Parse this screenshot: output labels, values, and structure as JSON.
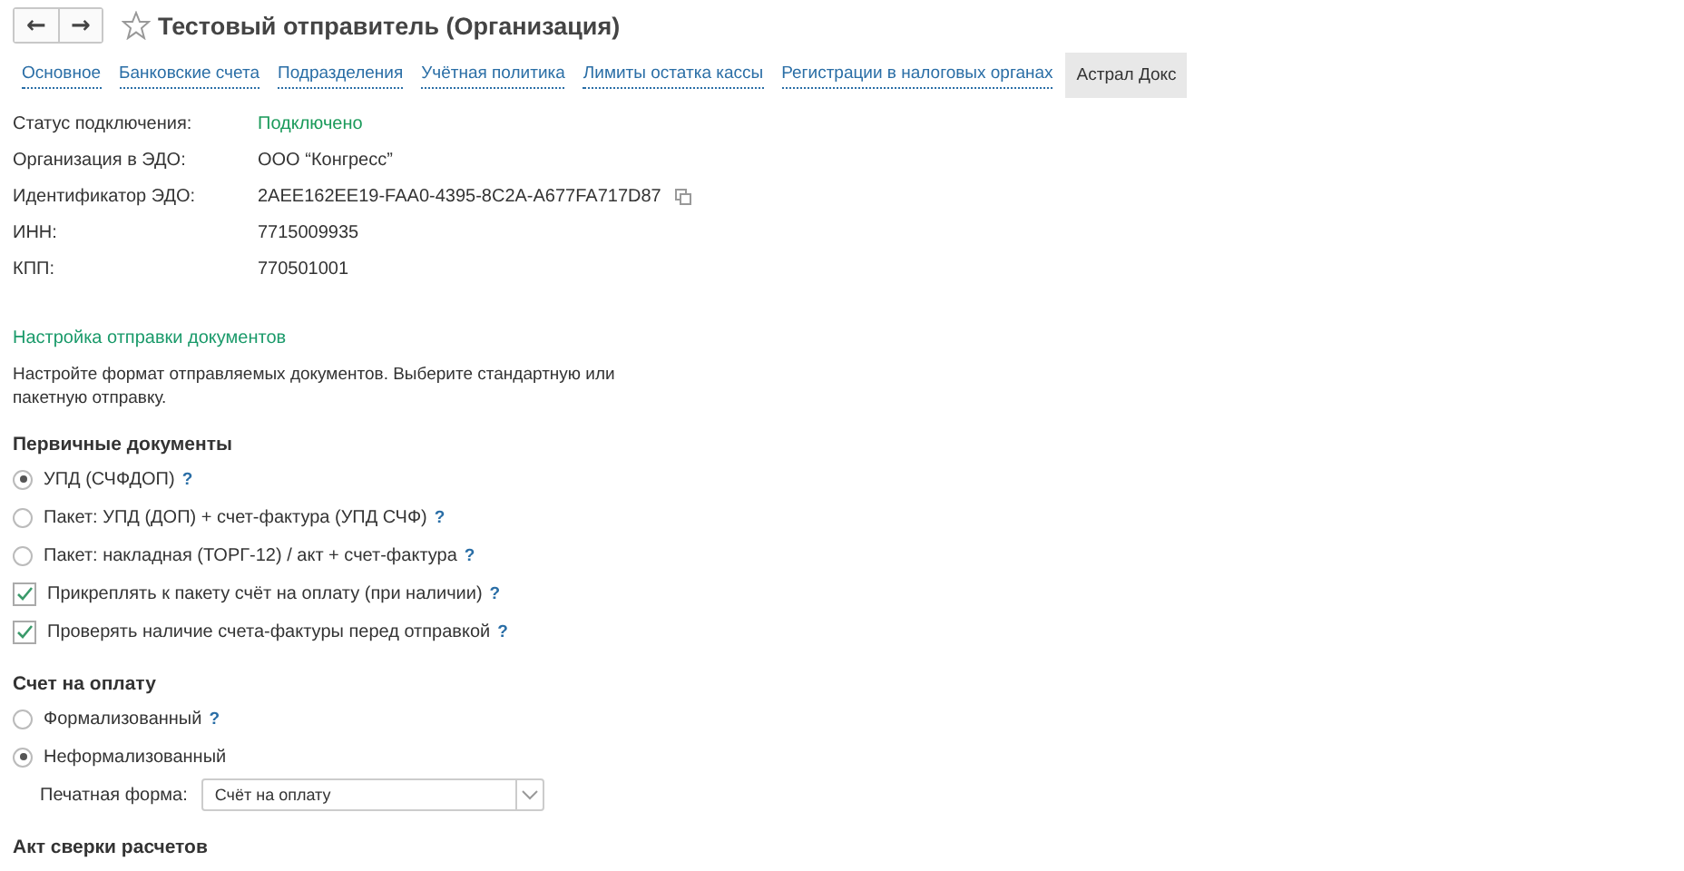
{
  "nav": {
    "back": "←",
    "forward": "→"
  },
  "window": {
    "title": "Тестовый отправитель (Организация)",
    "favorite": false
  },
  "tabs": [
    {
      "label": "Основное",
      "selected": false
    },
    {
      "label": "Банковские счета",
      "selected": false
    },
    {
      "label": "Подразделения",
      "selected": false
    },
    {
      "label": "Учётная политика",
      "selected": false
    },
    {
      "label": "Лимиты остатка кассы",
      "selected": false
    },
    {
      "label": "Регистрации в налоговых органах",
      "selected": false
    },
    {
      "label": "Астрал Докс",
      "selected": true
    }
  ],
  "fields": [
    {
      "label": "Статус подключения:",
      "value": "Подключено",
      "kind": "status"
    },
    {
      "label": "Организация в ЭДО:",
      "value": "ООО “Конгресс”",
      "kind": "text"
    },
    {
      "label": "Идентификатор ЭДО:",
      "value": "2AEE162EE19-FAA0-4395-8C2A-A677FA717D87",
      "kind": "copy"
    },
    {
      "label": "ИНН:",
      "value": "7715009935",
      "kind": "text"
    },
    {
      "label": "КПП:",
      "value": "770501001",
      "kind": "text"
    }
  ],
  "settings": {
    "title": "Настройка отправки документов",
    "description": "Настройте формат отправляемых документов. Выберите стандартную или пакетную отправку."
  },
  "sections": [
    {
      "title": "Первичные документы",
      "options": [
        {
          "kind": "radio",
          "label": "УПД (СЧФДОП)",
          "selected": true,
          "help": "?"
        },
        {
          "kind": "radio",
          "label": "Пакет: УПД (ДОП) + счет-фактура (УПД СЧФ)",
          "selected": false,
          "help": "?"
        },
        {
          "kind": "radio",
          "label": "Пакет: накладная (ТОРГ-12) / акт + счет-фактура",
          "selected": false,
          "help": "?"
        },
        {
          "kind": "checkbox",
          "label": "Прикреплять к пакету счёт на оплату (при наличии)",
          "checked": true,
          "help": "?"
        },
        {
          "kind": "checkbox",
          "label": "Проверять наличие счета-фактуры перед отправкой",
          "checked": true,
          "help": "?"
        }
      ]
    },
    {
      "title": "Счет на оплату",
      "options": [
        {
          "kind": "radio",
          "label": "Формализованный",
          "selected": false,
          "help": "?"
        },
        {
          "kind": "radio",
          "label": "Неформализованный",
          "selected": true
        },
        {
          "kind": "select",
          "label": "Печатная форма:",
          "value": "Счёт на оплату"
        }
      ]
    },
    {
      "title": "Акт сверки расчетов"
    }
  ]
}
